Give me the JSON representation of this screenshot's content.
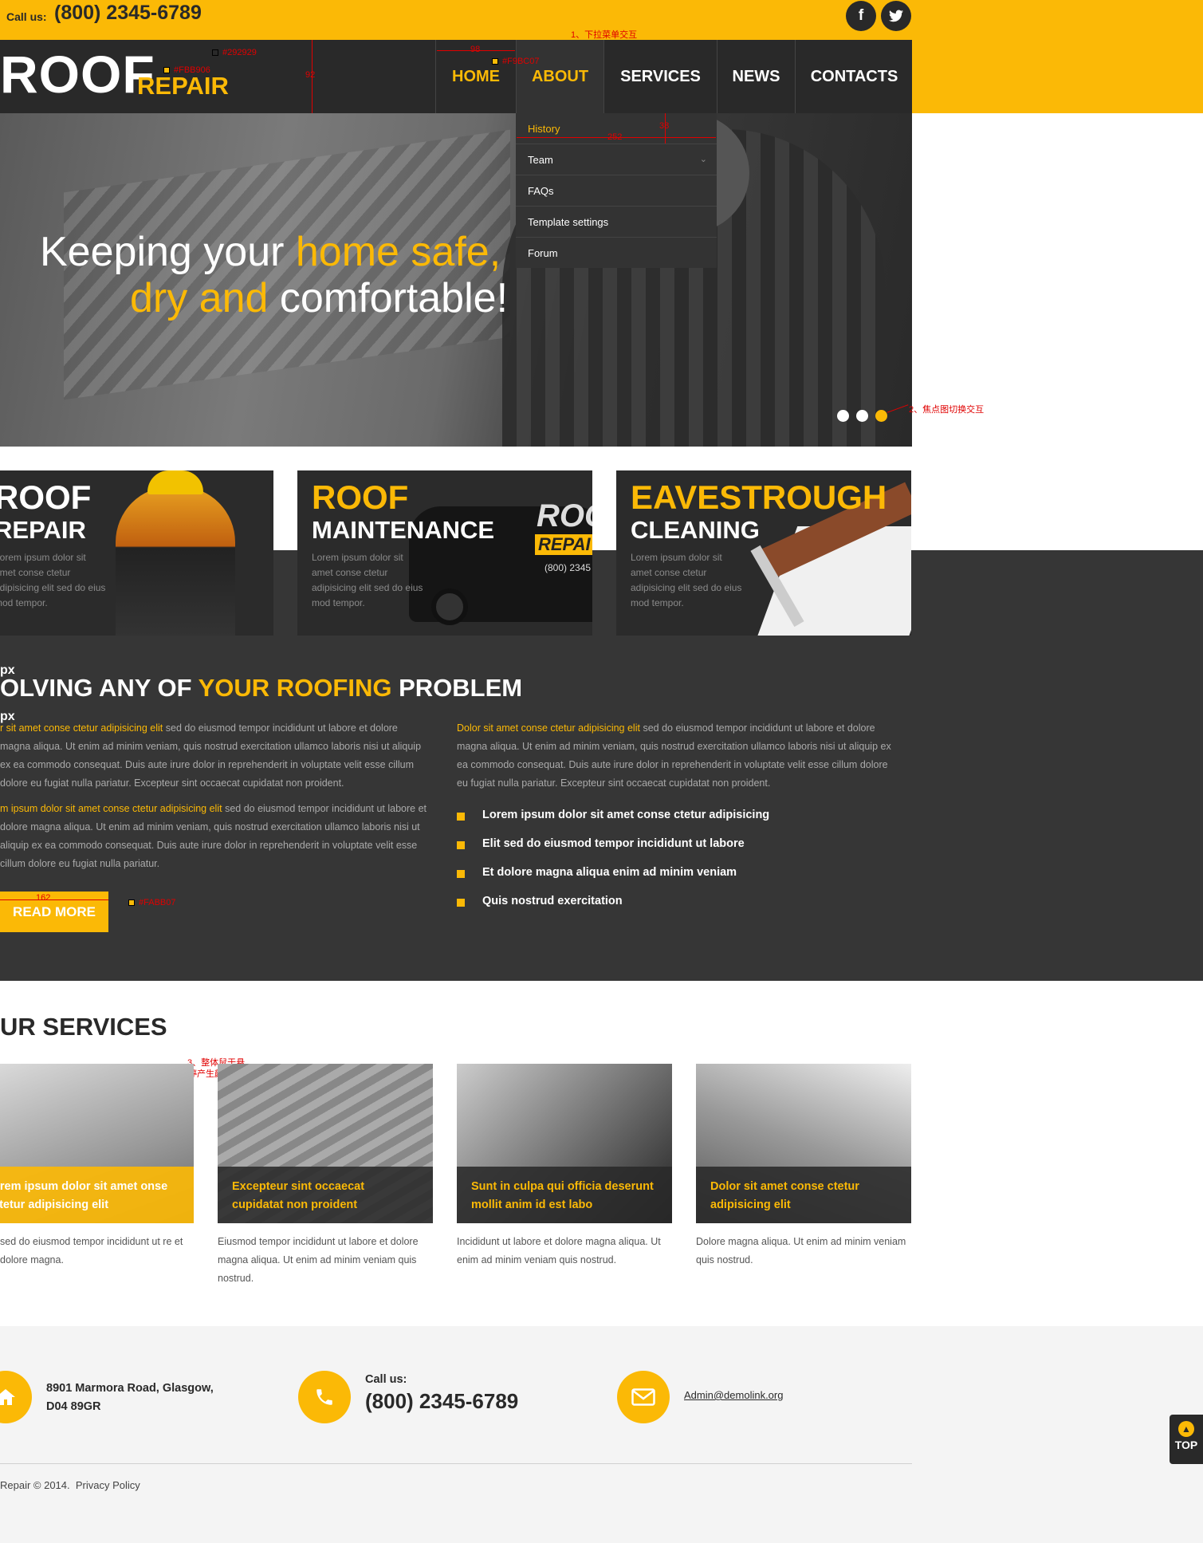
{
  "topbar": {
    "call_label": "Call us:",
    "phone": "(800) 2345-6789",
    "social": [
      {
        "icon": "facebook-icon",
        "glyph": "f"
      },
      {
        "icon": "twitter-icon",
        "glyph": "t"
      }
    ]
  },
  "logo": {
    "main": "ROOF",
    "sub": "REPAIR"
  },
  "nav": {
    "items": [
      "HOME",
      "ABOUT",
      "SERVICES",
      "NEWS",
      "CONTACTS"
    ],
    "dropdown": [
      "History",
      "Team",
      "FAQs",
      "Template settings",
      "Forum"
    ]
  },
  "annotations": {
    "color_header": "#292929",
    "color_logo": "#FBB906",
    "color_nav": "#F9BC07",
    "color_button": "#FABB07",
    "w98": "98",
    "h92": "92",
    "w252": "252",
    "h38": "38",
    "w162": "162",
    "note1": "1、下拉菜单交互",
    "note2": "2、焦点图切换交互",
    "note3a": "3、整体鼠于悬",
    "note3b": "停产生颜色变化"
  },
  "hero": {
    "line1_a": "Keeping your ",
    "line1_b": "home safe,",
    "line2_a": "dry and ",
    "line2_b": "comfortable!",
    "dots": 3,
    "active_dot": 3
  },
  "tiles": [
    {
      "title1": "ROOF",
      "title2": "REPAIR",
      "title1_color": "#ffffff",
      "text": "Lorem ipsum dolor sit amet conse ctetur adipisicing elit sed do eius mod tempor."
    },
    {
      "title1": "ROOF",
      "title2": "MAINTENANCE",
      "title1_color": "#fbb906",
      "text": "Lorem ipsum dolor sit amet conse ctetur adipisicing elit sed do eius mod tempor."
    },
    {
      "title1": "EAVESTROUGH",
      "title2": "CLEANING",
      "title1_color": "#fbb906",
      "text": "Lorem ipsum dolor sit amet conse ctetur adipisicing elit sed do eius mod tempor."
    }
  ],
  "van": {
    "logo1": "ROO",
    "logo2": "REPAI",
    "phone": "(800) 2345"
  },
  "solving": {
    "px1": "px",
    "px2": "px",
    "title_a": "OLVING ANY OF ",
    "title_b": "YOUR ROOFING",
    "title_c": " PROBLEM",
    "p1_hl": "r sit amet conse ctetur adipisicing elit",
    "p1": " sed do eiusmod tempor incididunt ut labore et dolore magna aliqua. Ut enim ad minim veniam, quis nostrud exercitation ullamco laboris nisi ut aliquip ex ea commodo consequat. Duis aute irure dolor in reprehenderit in voluptate velit esse cillum dolore eu fugiat nulla pariatur. Excepteur sint occaecat cupidatat non proident.",
    "p2_hl": "m ipsum dolor sit amet conse ctetur adipisicing elit",
    "p2": " sed do eiusmod tempor incididunt ut labore et dolore magna aliqua. Ut enim ad minim veniam, quis nostrud exercitation ullamco laboris nisi ut aliquip ex ea commodo consequat. Duis aute irure dolor in reprehenderit in voluptate velit esse cillum dolore eu fugiat nulla pariatur.",
    "p3_hl": "Dolor sit amet conse ctetur adipisicing elit",
    "p3": " sed do eiusmod tempor incididunt ut labore et dolore magna aliqua. Ut enim ad minim veniam, quis nostrud exercitation ullamco laboris nisi ut aliquip ex ea commodo consequat. Duis aute irure dolor in reprehenderit in voluptate velit esse cillum dolore eu fugiat nulla pariatur. Excepteur sint occaecat cupidatat non proident.",
    "bullets": [
      "Lorem ipsum dolor sit amet conse ctetur adipisicing",
      "Elit sed do eiusmod tempor incididunt ut labore",
      "Et dolore magna aliqua enim ad minim veniam",
      "Quis nostrud exercitation"
    ],
    "read_more": "READ MORE"
  },
  "services": {
    "title": "UR SERVICES",
    "cards": [
      {
        "caption": "orem ipsum dolor sit amet onse ctetur adipisicing elit",
        "desc": "sed do eiusmod tempor incididunt ut re et dolore magna."
      },
      {
        "caption": "Excepteur sint occaecat cupidatat non proident",
        "desc": "Eiusmod tempor incididunt ut labore et dolore magna aliqua. Ut enim ad minim veniam quis nostrud."
      },
      {
        "caption": "Sunt in culpa qui officia deserunt mollit anim id est labo",
        "desc": "Incididunt ut labore et dolore magna aliqua. Ut enim ad minim veniam quis nostrud."
      },
      {
        "caption": "Dolor sit amet conse ctetur adipisicing elit",
        "desc": "Dolore magna aliqua. Ut enim ad minim veniam quis nostrud."
      }
    ]
  },
  "footer": {
    "address1": "8901 Marmora Road, Glasgow,",
    "address2": "D04 89GR",
    "call_label": "Call us:",
    "phone": "(800) 2345-6789",
    "email": "Admin@demolink.org",
    "copyright": "Repair © 2014.",
    "privacy": "Privacy Policy",
    "top_label": "TOP"
  }
}
